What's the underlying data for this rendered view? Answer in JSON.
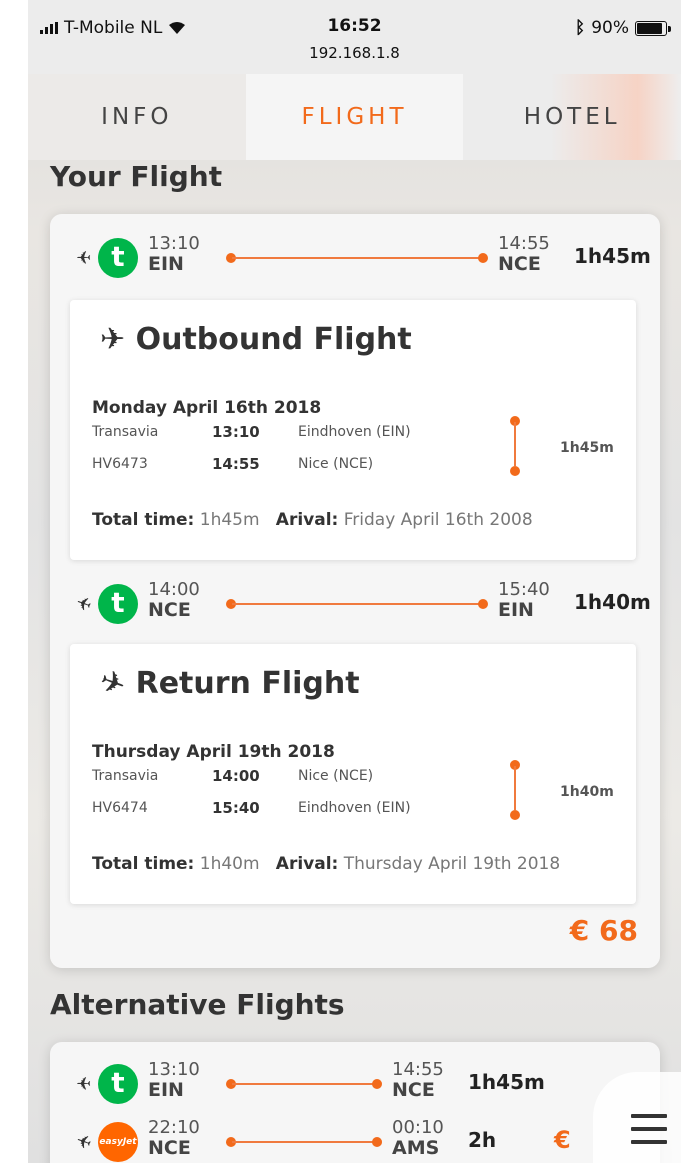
{
  "status_bar": {
    "carrier": "T-Mobile NL",
    "time": "16:52",
    "url": "192.168.1.8",
    "battery": "90%"
  },
  "tabs": [
    {
      "label": "INFO",
      "active": false
    },
    {
      "label": "FLIGHT",
      "active": true
    },
    {
      "label": "HOTEL",
      "active": false
    }
  ],
  "your_flight": {
    "title": "Your Flight",
    "outbound_summary": {
      "dep_time": "13:10",
      "dep_code": "EIN",
      "arr_time": "14:55",
      "arr_code": "NCE",
      "duration": "1h45m"
    },
    "outbound": {
      "title": "Outbound Flight",
      "date": "Monday April 16th 2018",
      "airline": "Transavia",
      "flight_no": "HV6473",
      "dep_time": "13:10",
      "arr_time": "14:55",
      "dep_airport": "Eindhoven (EIN)",
      "arr_airport": "Nice (NCE)",
      "duration": "1h45m",
      "total_label": "Total time:",
      "total_value": "1h45m",
      "arrival_label": "Arival:",
      "arrival_value": "Friday April 16th 2008"
    },
    "return_summary": {
      "dep_time": "14:00",
      "dep_code": "NCE",
      "arr_time": "15:40",
      "arr_code": "EIN",
      "duration": "1h40m"
    },
    "return": {
      "title": "Return Flight",
      "date": "Thursday April 19th 2018",
      "airline": "Transavia",
      "flight_no": "HV6474",
      "dep_time": "14:00",
      "arr_time": "15:40",
      "dep_airport": "Nice (NCE)",
      "arr_airport": "Eindhoven (EIN)",
      "duration": "1h40m",
      "total_label": "Total time:",
      "total_value": "1h40m",
      "arrival_label": "Arival:",
      "arrival_value": "Thursday April 19th 2018"
    },
    "price": "€ 68"
  },
  "alternative": {
    "title": "Alternative Flights",
    "rows": [
      {
        "dep_time": "13:10",
        "dep_code": "EIN",
        "arr_time": "14:55",
        "arr_code": "NCE",
        "duration": "1h45m"
      },
      {
        "airline_logo_text": "easyJet",
        "dep_time": "22:10",
        "dep_code": "NCE",
        "arr_time": "00:10",
        "arr_code": "AMS",
        "duration": "2h",
        "price": "€"
      }
    ]
  },
  "icons": {
    "logo_transavia": "t",
    "plane_outbound": "✈",
    "plane_return": "✈"
  },
  "colors": {
    "accent": "#f26a1b",
    "transavia_green": "#00b54a",
    "easyjet_orange": "#ff6600"
  }
}
